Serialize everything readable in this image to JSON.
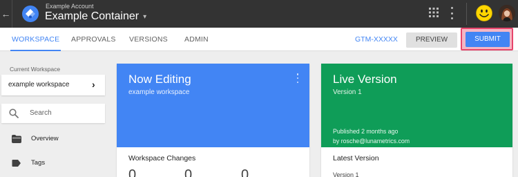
{
  "topbar": {
    "back_icon": "arrow-back-icon",
    "logo_icon": "gtm-diamond-logo",
    "account_name": "Example Account",
    "container_name": "Example Container",
    "container_caret": "▾",
    "apps_icon": "grid-apps-icon",
    "more_icon": "vertical-dots-icon",
    "smiley_icon": "smiley-face-icon"
  },
  "nav": {
    "tabs": [
      {
        "label": "WORKSPACE",
        "active": true
      },
      {
        "label": "APPROVALS",
        "active": false
      },
      {
        "label": "VERSIONS",
        "active": false
      },
      {
        "label": "ADMIN",
        "active": false
      }
    ],
    "container_id": "GTM-XXXXX",
    "preview_label": "PREVIEW",
    "submit_label": "SUBMIT"
  },
  "sidebar": {
    "current_workspace_label": "Current Workspace",
    "workspace_name": "example workspace",
    "workspace_chevron": "›",
    "search_placeholder": "Search",
    "items": [
      {
        "label": "Overview",
        "icon": "folder-icon"
      },
      {
        "label": "Tags",
        "icon": "tag-icon"
      }
    ]
  },
  "cards": {
    "now_editing": {
      "title": "Now Editing",
      "subtitle": "example workspace",
      "section_title": "Workspace Changes",
      "counts": [
        "0",
        "0",
        "0"
      ]
    },
    "live_version": {
      "title": "Live Version",
      "subtitle": "Version 1",
      "published": "Published 2 months ago",
      "published_by": "by rosche@lunametrics.com",
      "section_title": "Latest Version",
      "latest_version": "Version 1"
    }
  },
  "colors": {
    "topbar": "#333333",
    "accent": "#4285f4",
    "live_green": "#0f9d58",
    "submit_highlight": "#e6456b"
  }
}
